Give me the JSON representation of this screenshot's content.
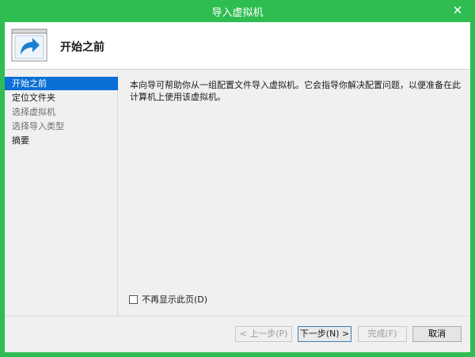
{
  "window": {
    "title": "导入虚拟机",
    "close_glyph": "✕"
  },
  "header": {
    "title": "开始之前",
    "icon": "share-arrow-icon"
  },
  "sidebar": {
    "items": [
      {
        "label": "开始之前",
        "state": "active"
      },
      {
        "label": "定位文件夹",
        "state": "normal"
      },
      {
        "label": "选择虚拟机",
        "state": "disabled"
      },
      {
        "label": "选择导入类型",
        "state": "disabled"
      },
      {
        "label": "摘要",
        "state": "normal"
      }
    ]
  },
  "content": {
    "description": "本向导可帮助你从一组配置文件导入虚拟机。它会指导你解决配置问题，以便准备在此计算机上使用该虚拟机。"
  },
  "options": {
    "skip_page_label": "不再显示此页(D)",
    "skip_page_checked": false
  },
  "buttons": {
    "prev": "< 上一步(P)",
    "next": "下一步(N) >",
    "finish": "完成(F)",
    "cancel": "取消"
  },
  "colors": {
    "title_bar": "#2fbd52",
    "selection": "#0a6fd6"
  }
}
